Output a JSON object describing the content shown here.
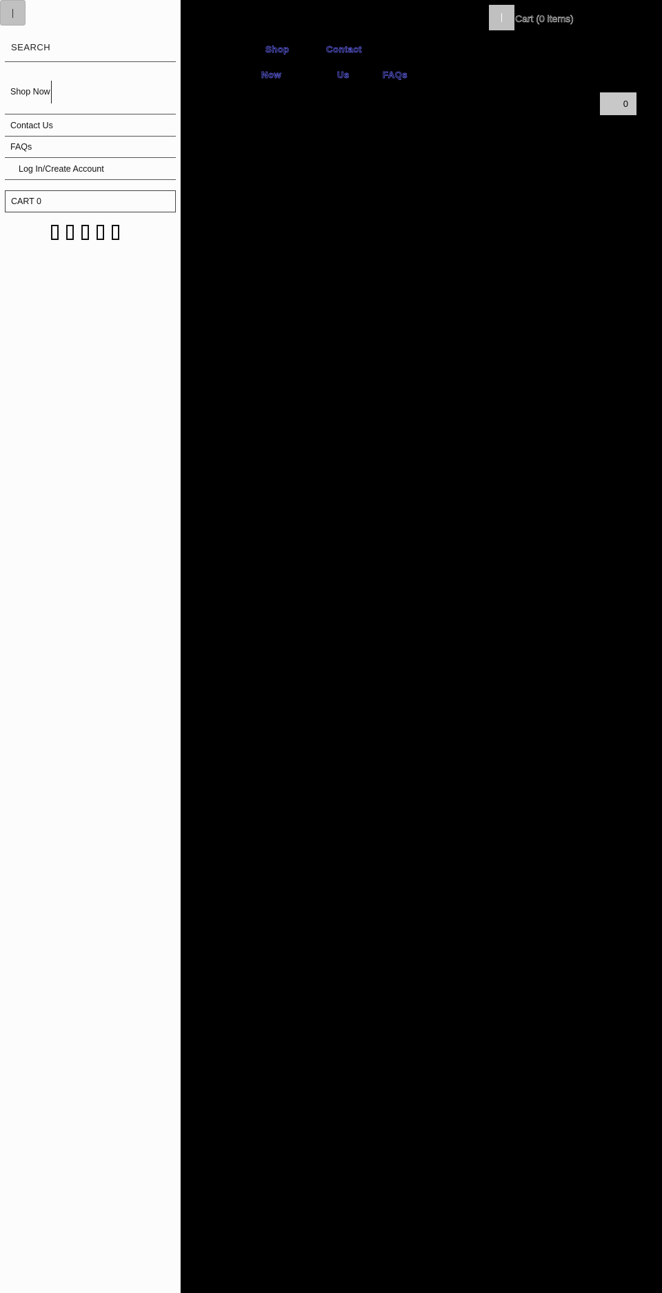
{
  "sidebar": {
    "search_label": "SEARCH",
    "items": [
      {
        "label": "Shop Now"
      },
      {
        "label": "Contact Us"
      },
      {
        "label": "FAQs"
      },
      {
        "label": "Log In/Create Account"
      }
    ],
    "cart_label": "CART 0",
    "social_icons": [
      "social-icon-1",
      "social-icon-2",
      "social-icon-3",
      "social-icon-4",
      "social-icon-5"
    ]
  },
  "header": {
    "cart_link": "Cart (0 items)",
    "nav": {
      "shop_line1": "Shop",
      "shop_line2": "Now",
      "contact_line1": "Contact",
      "contact_line2": "Us",
      "faqs": "FAQs"
    },
    "cart_count": "0"
  },
  "colors": {
    "page_background": "#000000",
    "sidebar_background": "#fcfcfc",
    "nav_link_outline": "#6a6aff",
    "button_gray": "#c0c0c0"
  }
}
